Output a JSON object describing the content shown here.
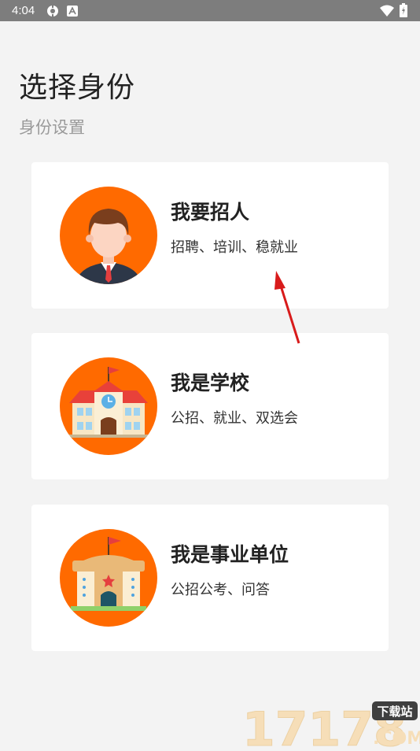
{
  "status_bar": {
    "time": "4:04"
  },
  "header": {
    "title": "选择身份",
    "subtitle": "身份设置"
  },
  "options": [
    {
      "title": "我要招人",
      "desc": "招聘、培训、稳就业",
      "icon": "recruiter-avatar-icon"
    },
    {
      "title": "我是学校",
      "desc": "公招、就业、双选会",
      "icon": "school-building-icon"
    },
    {
      "title": "我是事业单位",
      "desc": "公招公考、问答",
      "icon": "public-institution-icon"
    }
  ],
  "watermark": {
    "number": "17178",
    "badge": "下载站",
    "domain": ".COM"
  },
  "colors": {
    "accent": "#ff6a00",
    "background": "#f3f3f3",
    "card": "#ffffff"
  }
}
